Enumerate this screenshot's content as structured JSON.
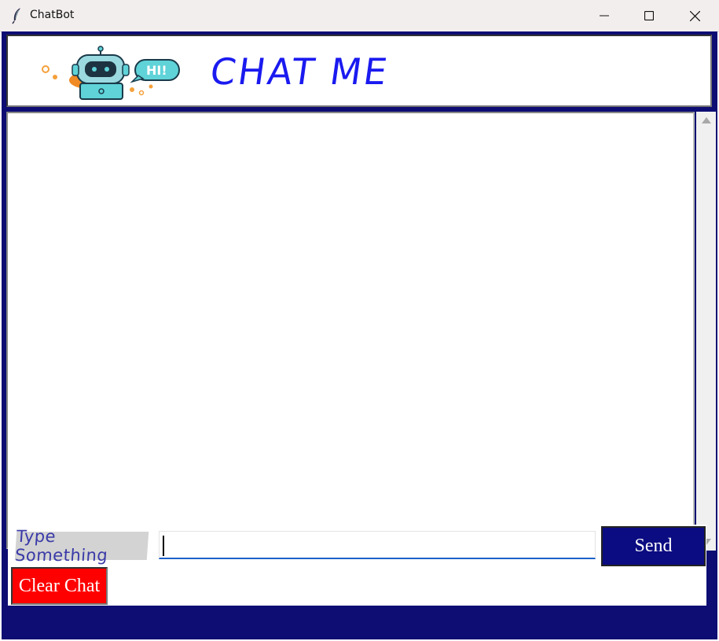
{
  "window": {
    "title": "ChatBot",
    "controls": [
      "minimize-icon",
      "maximize-icon",
      "close-icon"
    ]
  },
  "header": {
    "logo_text": "HI!",
    "title": "CHAT ME"
  },
  "chat": {
    "messages": []
  },
  "input_bar": {
    "prompt_label": "Type Something",
    "message_value": "",
    "send_label": "Send",
    "clear_label": "Clear Chat"
  },
  "colors": {
    "frame": "#0d0d73",
    "title_text": "#1a1af0",
    "send_button": "#0b0b82",
    "clear_button": "#ff0000",
    "input_underline": "#1e60c8"
  }
}
